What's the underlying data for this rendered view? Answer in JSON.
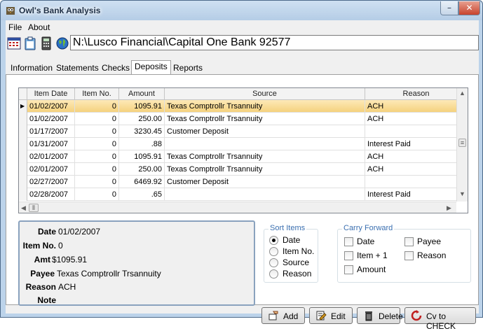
{
  "window": {
    "title": "Owl's Bank Analysis",
    "minimize": "–",
    "close": "✕"
  },
  "menu": [
    "File",
    "About"
  ],
  "path": "N:\\Lusco Financial\\Capital One Bank 92577",
  "tabs": [
    "Information",
    "Statements",
    "Checks",
    "Deposits",
    "Reports"
  ],
  "active_tab": "Deposits",
  "grid": {
    "columns": [
      "Item Date",
      "Item No.",
      "Amount",
      "Source",
      "Reason"
    ],
    "rows": [
      {
        "date": "01/02/2007",
        "no": "0",
        "amount": "1095.91",
        "source": "Texas Comptrollr Trsannuity",
        "reason": "ACH",
        "selected": true
      },
      {
        "date": "01/02/2007",
        "no": "0",
        "amount": "250.00",
        "source": "Texas Comptrollr Trsannuity",
        "reason": "ACH"
      },
      {
        "date": "01/17/2007",
        "no": "0",
        "amount": "3230.45",
        "source": "Customer Deposit",
        "reason": ""
      },
      {
        "date": "01/31/2007",
        "no": "0",
        "amount": ".88",
        "source": "",
        "reason": "Interest Paid"
      },
      {
        "date": "02/01/2007",
        "no": "0",
        "amount": "1095.91",
        "source": "Texas Comptrollr Trsannuity",
        "reason": "ACH"
      },
      {
        "date": "02/01/2007",
        "no": "0",
        "amount": "250.00",
        "source": "Texas Comptrollr Trsannuity",
        "reason": "ACH"
      },
      {
        "date": "02/27/2007",
        "no": "0",
        "amount": "6469.92",
        "source": "Customer Deposit",
        "reason": ""
      },
      {
        "date": "02/28/2007",
        "no": "0",
        "amount": ".65",
        "source": "",
        "reason": "Interest Paid"
      }
    ]
  },
  "details": {
    "date_label": "Date",
    "date": "01/02/2007",
    "itemno_label": "Item No.",
    "itemno": "0",
    "amt_label": "Amt",
    "amt": "$1095.91",
    "payee_label": "Payee",
    "payee": "Texas Comptrollr Trsannuity",
    "reason_label": "Reason",
    "reason": "ACH",
    "note_label": "Note",
    "note": ""
  },
  "sort_items": {
    "title": "Sort Items",
    "options": [
      "Date",
      "Item No.",
      "Source",
      "Reason"
    ],
    "selected": "Date"
  },
  "carry_forward": {
    "title": "Carry Forward",
    "options": [
      "Date",
      "Payee",
      "Item + 1",
      "Reason",
      "Amount"
    ]
  },
  "buttons": {
    "add": "Add",
    "edit": "Edit",
    "delete": "Delete",
    "cv": "Cv to CHECK"
  },
  "colors": {
    "selected_row": "#f5d27e",
    "group_title": "#3a6fb0",
    "frame": "#bcd3ea"
  }
}
